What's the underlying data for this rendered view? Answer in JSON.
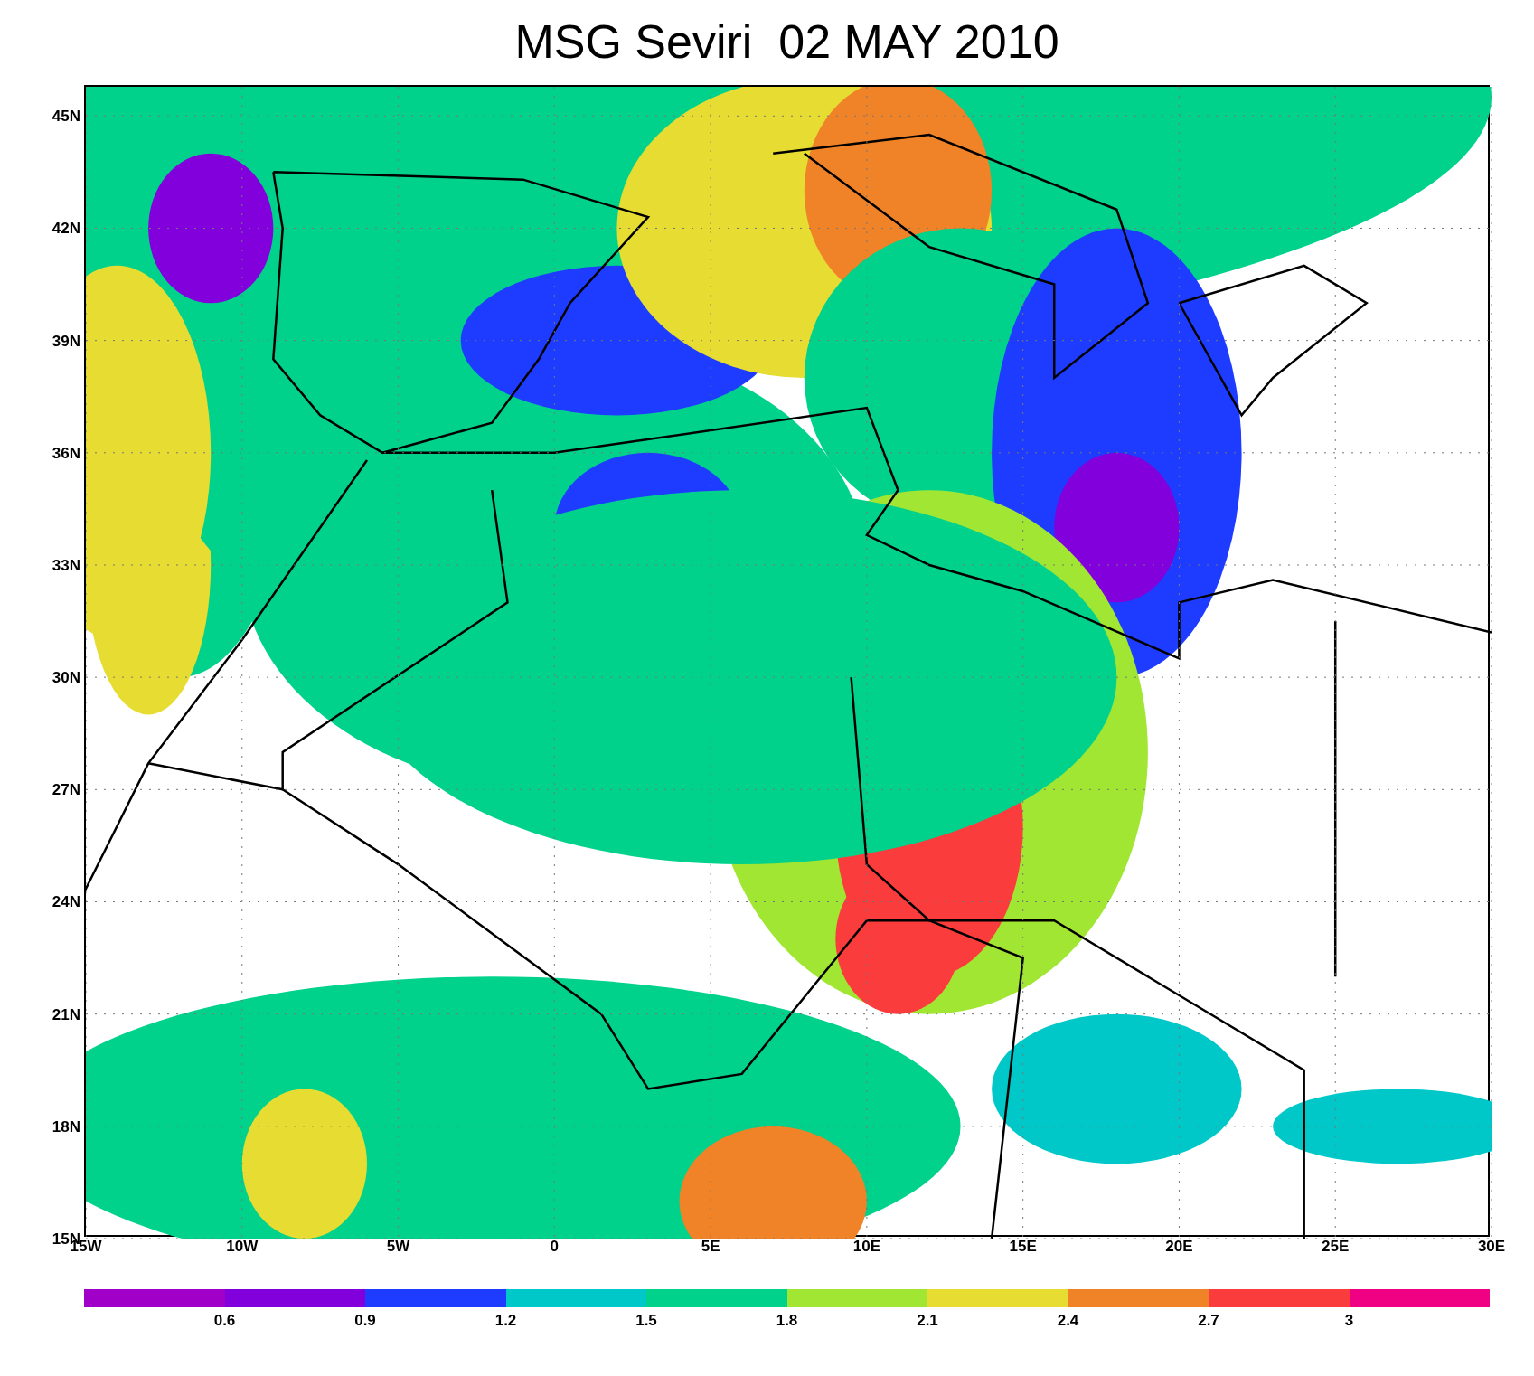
{
  "title": "MSG Seviri  02 MAY 2010",
  "y_axis": {
    "ticks": [
      "45N",
      "42N",
      "39N",
      "36N",
      "33N",
      "30N",
      "27N",
      "24N",
      "21N",
      "18N",
      "15N"
    ]
  },
  "x_axis": {
    "ticks": [
      "15W",
      "10W",
      "5W",
      "0",
      "5E",
      "10E",
      "15E",
      "20E",
      "25E",
      "30E"
    ]
  },
  "colorbar": {
    "segments": [
      {
        "color": "#a000c8"
      },
      {
        "color": "#8200dc"
      },
      {
        "color": "#1e3cff"
      },
      {
        "color": "#00c8c8"
      },
      {
        "color": "#00d28c"
      },
      {
        "color": "#a0e632"
      },
      {
        "color": "#e6dc32"
      },
      {
        "color": "#f08228"
      },
      {
        "color": "#fa3c3c"
      },
      {
        "color": "#f00082"
      }
    ],
    "labels": [
      "0.6",
      "0.9",
      "1.2",
      "1.5",
      "1.8",
      "2.1",
      "2.4",
      "2.7",
      "3"
    ]
  }
}
